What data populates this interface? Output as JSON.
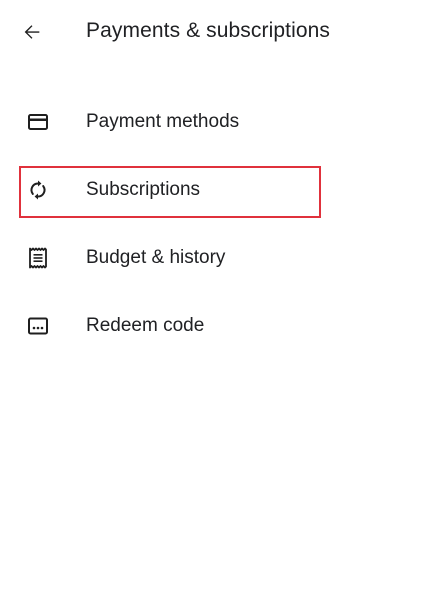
{
  "header": {
    "back_icon": "arrow-back-icon",
    "title": "Payments & subscriptions"
  },
  "menu": {
    "items": [
      {
        "label": "Payment methods",
        "icon": "credit-card-icon"
      },
      {
        "label": "Subscriptions",
        "icon": "sync-icon"
      },
      {
        "label": "Budget & history",
        "icon": "receipt-icon"
      },
      {
        "label": "Redeem code",
        "icon": "redeem-code-icon"
      }
    ]
  },
  "colors": {
    "text": "#202124",
    "icon": "#1f1f1f",
    "highlight": "#e0313c",
    "background": "#ffffff"
  }
}
